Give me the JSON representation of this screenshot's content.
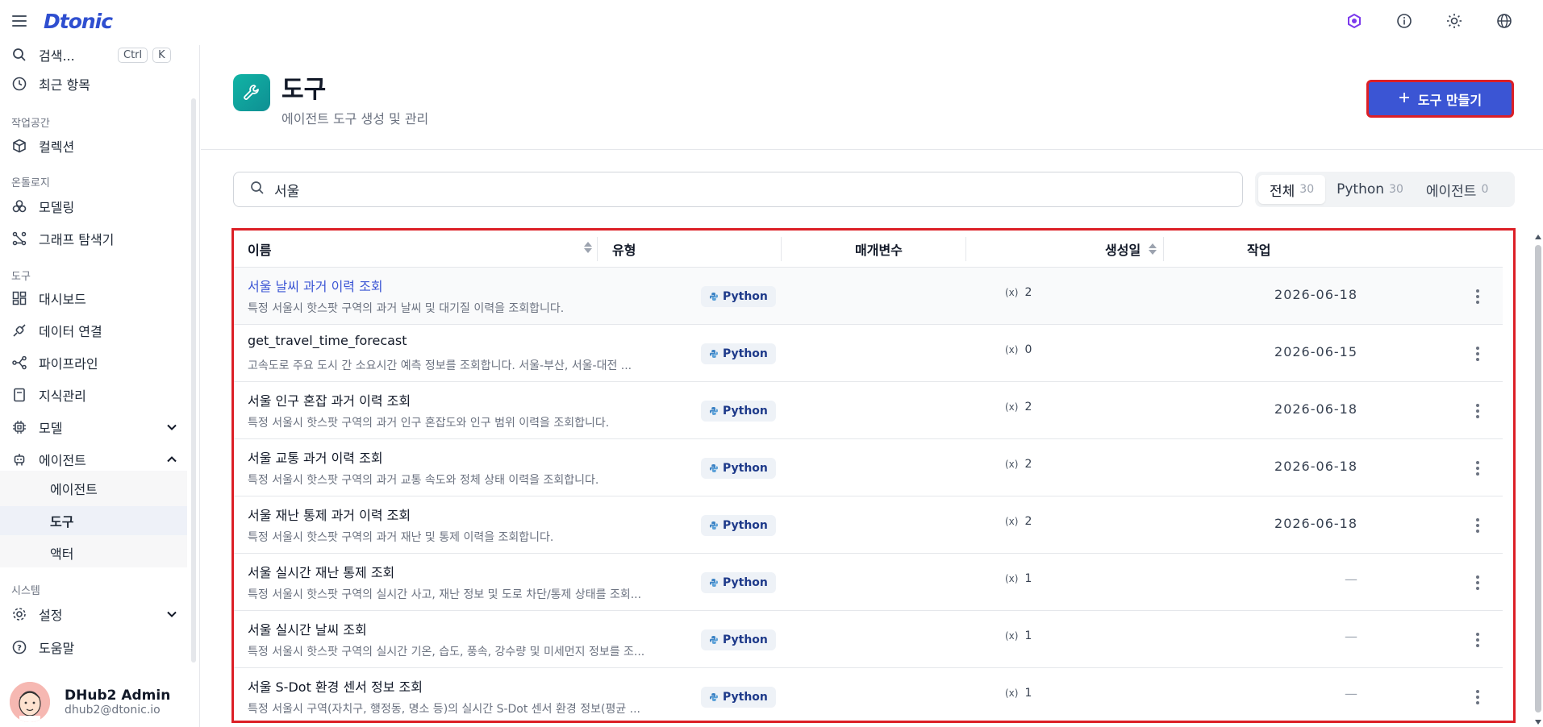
{
  "app": {
    "logo": "Dtonic"
  },
  "sidebar": {
    "search_label": "검색...",
    "search_kbd1": "Ctrl",
    "search_kbd2": "K",
    "recent": "최근 항목",
    "sec_workspace": "작업공간",
    "collection": "컬렉션",
    "sec_ontology": "온톨로지",
    "modeling": "모델링",
    "graph": "그래프 탐색기",
    "sec_tools": "도구",
    "dashboard": "대시보드",
    "data_conn": "데이터 연결",
    "pipeline": "파이프라인",
    "knowledge": "지식관리",
    "model": "모델",
    "agent": "에이전트",
    "sub_agent": "에이전트",
    "sub_tool": "도구",
    "sub_actor": "액터",
    "sec_system": "시스템",
    "settings": "설정",
    "help": "도움말"
  },
  "user": {
    "name": "DHub2 Admin",
    "email": "dhub2@dtonic.io"
  },
  "page": {
    "title": "도구",
    "subtitle": "에이전트 도구 생성 및 관리",
    "create_button": "도구 만들기"
  },
  "search": {
    "value": "서울"
  },
  "filters": [
    {
      "label": "전체",
      "count": "30"
    },
    {
      "label": "Python",
      "count": "30"
    },
    {
      "label": "에이전트",
      "count": "0"
    }
  ],
  "table": {
    "headers": {
      "name": "이름",
      "type": "유형",
      "params": "매개변수",
      "created": "생성일",
      "action": "작업"
    },
    "rows": [
      {
        "name": "서울 날씨 과거 이력 조회",
        "desc": "특정 서울시 핫스팟 구역의 과거 날씨 및 대기질 이력을 조회합니다.",
        "type": "Python",
        "params": "2",
        "created": "2026-06-18"
      },
      {
        "name": "get_travel_time_forecast",
        "desc": "고속도로 주요 도시 간 소요시간 예측 정보를 조회합니다. 서울-부산, 서울-대전 ...",
        "type": "Python",
        "params": "0",
        "created": "2026-06-15"
      },
      {
        "name": "서울 인구 혼잡 과거 이력 조회",
        "desc": "특정 서울시 핫스팟 구역의 과거 인구 혼잡도와 인구 범위 이력을 조회합니다.",
        "type": "Python",
        "params": "2",
        "created": "2026-06-18"
      },
      {
        "name": "서울 교통 과거 이력 조회",
        "desc": "특정 서울시 핫스팟 구역의 과거 교통 속도와 정체 상태 이력을 조회합니다.",
        "type": "Python",
        "params": "2",
        "created": "2026-06-18"
      },
      {
        "name": "서울 재난 통제 과거 이력 조회",
        "desc": "특정 서울시 핫스팟 구역의 과거 재난 및 통제 이력을 조회합니다.",
        "type": "Python",
        "params": "2",
        "created": "2026-06-18"
      },
      {
        "name": "서울 실시간 재난 통제 조회",
        "desc": "특정 서울시 핫스팟 구역의 실시간 사고, 재난 정보 및 도로 차단/통제 상태를 조회...",
        "type": "Python",
        "params": "1",
        "created": "—"
      },
      {
        "name": "서울 실시간 날씨 조회",
        "desc": "특정 서울시 핫스팟 구역의 실시간 기온, 습도, 풍속, 강수량 및 미세먼지 정보를 조...",
        "type": "Python",
        "params": "1",
        "created": "—"
      },
      {
        "name": "서울 S-Dot 환경 센서 정보 조회",
        "desc": "특정 서울시 구역(자치구, 행정동, 명소 등)의 실시간 S-Dot 센서 환경 정보(평균 ...",
        "type": "Python",
        "params": "1",
        "created": "—"
      }
    ]
  },
  "params_icon_text": "(x)",
  "colors": {
    "primary": "#3b55d4",
    "highlight": "#dc1f26",
    "teal": "#10b4a5"
  }
}
